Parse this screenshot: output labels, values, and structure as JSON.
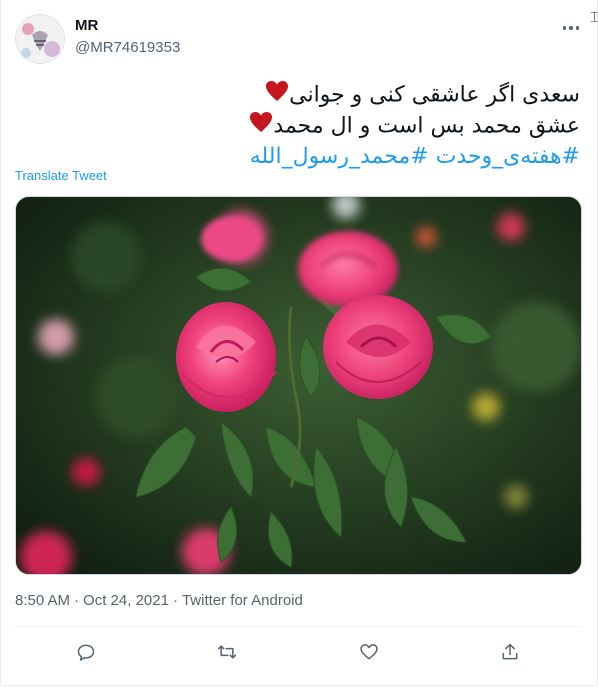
{
  "author": {
    "name": "MR",
    "handle": "@MR74619353"
  },
  "tweet": {
    "lines": [
      "سعدی اگر عاشقی کنی و جوانی",
      "عشق محمد بس است و ال محمد"
    ],
    "hashtags": [
      "#هفته‌ی_وحدت",
      "#محمد_رسول_الله"
    ],
    "heart_emoji": "heart-icon"
  },
  "translate_label": "Translate Tweet",
  "meta": {
    "time": "8:50 AM",
    "date": "Oct 24, 2021",
    "source": "Twitter for Android",
    "separator": "·"
  },
  "icons": {
    "more": "more-dots-icon",
    "reply": "reply-icon",
    "retweet": "retweet-icon",
    "like": "like-icon",
    "share": "share-icon"
  },
  "colors": {
    "accent": "#1d9bf0",
    "heart": "#c4161c",
    "muted": "#536471"
  }
}
